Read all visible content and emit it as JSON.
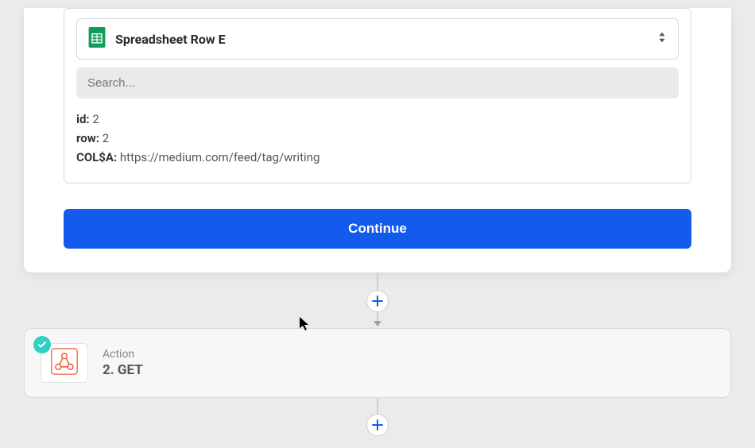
{
  "rowSelector": {
    "dropdownLabel": "Spreadsheet Row E",
    "searchPlaceholder": "Search...",
    "fields": {
      "id": {
        "label": "id:",
        "value": "2"
      },
      "row": {
        "label": "row:",
        "value": "2"
      },
      "col": {
        "label": "COL$A:",
        "value": "https://medium.com/feed/tag/writing"
      }
    }
  },
  "continueLabel": "Continue",
  "actionStep": {
    "label": "Action",
    "title": "2. GET"
  }
}
